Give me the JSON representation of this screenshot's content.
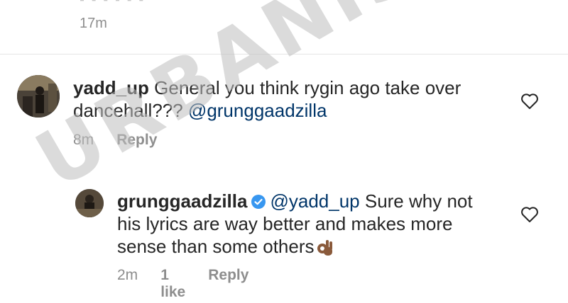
{
  "previous_comment": {
    "time": "17m"
  },
  "comments": [
    {
      "username": "yadd_up",
      "text_line1": " General you think rygin ago take over",
      "text_line2_plain": "dancehall??? ",
      "mention": "@grunggaadzilla",
      "time": "8m",
      "reply_label": "Reply"
    }
  ],
  "reply": {
    "username": "grunggaadzilla",
    "verified": true,
    "mention": "@yadd_up",
    "text_line1_rest": " Sure why not",
    "text_line2": "his lyrics are way better and makes more",
    "text_line3": "sense than some others",
    "emoji": "ok-hand-emoji",
    "time": "2m",
    "likes": "1 like",
    "reply_label": "Reply"
  },
  "watermark": "URBANISLANDZ",
  "colors": {
    "mention": "#003569",
    "meta": "#8e8e8e",
    "verified": "#3897f0"
  }
}
